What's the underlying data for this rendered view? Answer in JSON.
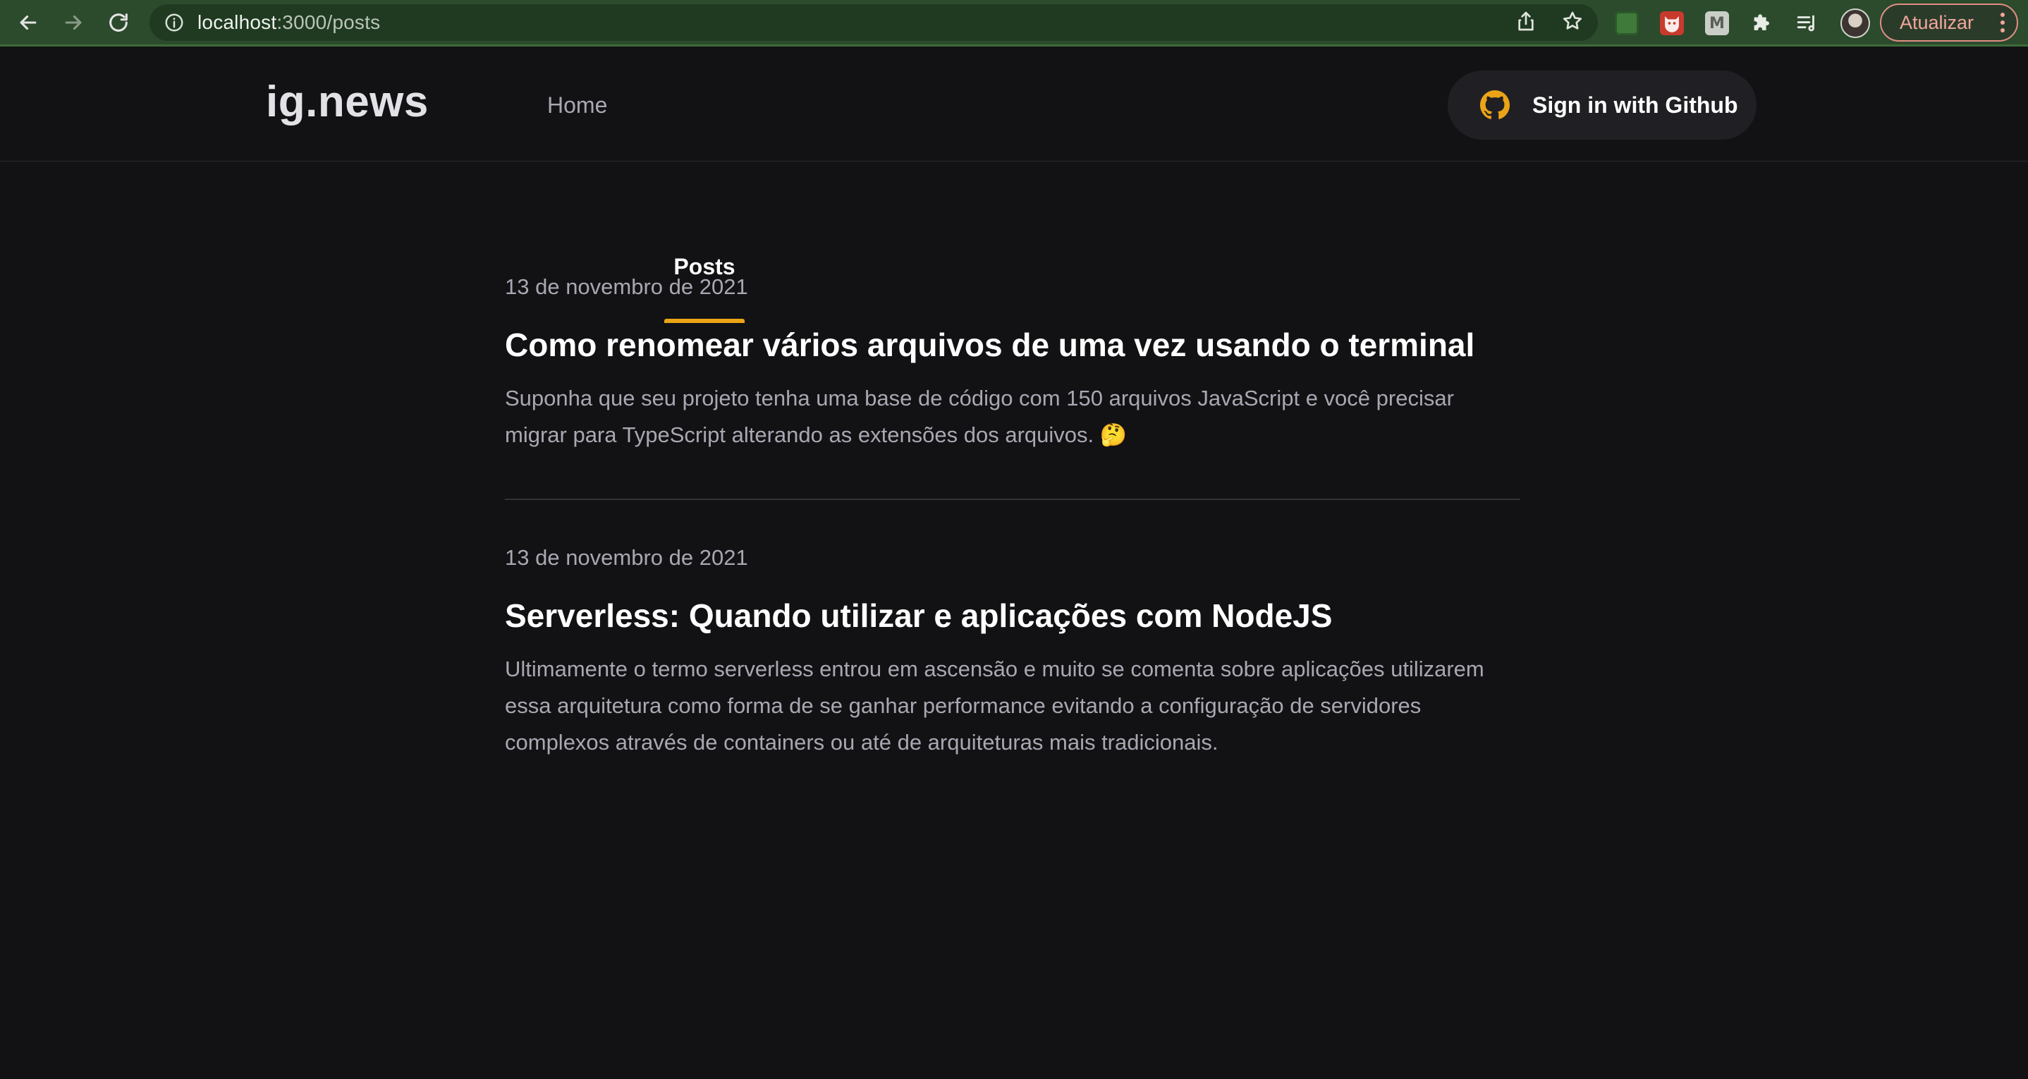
{
  "browser": {
    "url_host": "localhost",
    "url_path": ":3000/posts",
    "update_label": "Atualizar",
    "extension_m_letter": "M"
  },
  "header": {
    "logo": "ig.news",
    "nav": [
      {
        "label": "Home",
        "active": false
      },
      {
        "label": "Posts",
        "active": true
      }
    ],
    "signin_label": "Sign in with Github",
    "accent_color": "#eba417"
  },
  "posts": [
    {
      "date": "13 de novembro de 2021",
      "title": "Como renomear vários arquivos de uma vez usando o terminal",
      "excerpt": "Suponha que seu projeto tenha uma base de código com 150 arquivos JavaScript e você precisar migrar para TypeScript alterando as extensões dos arquivos. 🤔"
    },
    {
      "date": "13 de novembro de 2021",
      "title": "Serverless: Quando utilizar e aplicações com NodeJS",
      "excerpt": "Ultimamente o termo serverless entrou em ascensão e muito se comenta sobre aplicações utilizarem essa arquitetura como forma de se ganhar performance evitando a configuração de servidores complexos através de containers ou até de arquiteturas mais tradicionais."
    }
  ]
}
